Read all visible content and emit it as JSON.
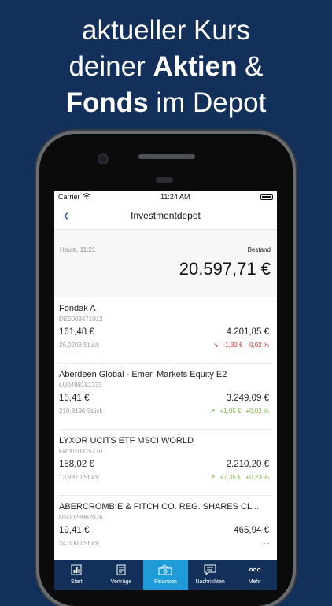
{
  "headline": {
    "line1": "aktueller Kurs",
    "line2_prefix": "deiner ",
    "line2_bold": "Aktien",
    "line2_suffix": " &",
    "line3_bold": "Fonds",
    "line3_suffix": " im Depot"
  },
  "status": {
    "carrier": "Carrier",
    "time": "11:24 AM"
  },
  "nav": {
    "title": "Investmentdepot",
    "back": "‹"
  },
  "summary": {
    "date": "Heute, 11:21",
    "label": "Bestand",
    "total": "20.597,71 €"
  },
  "holdings": [
    {
      "name": "Fondak A",
      "isin": "DE0008471012",
      "price": "161,48 €",
      "qty": "26,0208 Stück",
      "value": "4.201,85 €",
      "arrow": "↘",
      "abs": "-1,30 €",
      "pct": "-0,02 %",
      "trend": "neg"
    },
    {
      "name": "Aberdeen Global - Emer. Markets Equity E2",
      "isin": "LU0498181733",
      "price": "15,41 €",
      "qty": "210,8196 Stück",
      "value": "3.249,09 €",
      "arrow": "↗",
      "abs": "+1,05 €",
      "pct": "+0,02 %",
      "trend": "pos"
    },
    {
      "name": "LYXOR UCITS ETF MSCI WORLD",
      "isin": "FR0010315770",
      "price": "158,02 €",
      "qty": "13,9870 Stück",
      "value": "2.210,20 €",
      "arrow": "↗",
      "abs": "+7,35 €",
      "pct": "+0,23 %",
      "trend": "pos"
    },
    {
      "name": "ABERCROMBIE & FITCH CO. REG. SHARES CL...",
      "isin": "US0028962076",
      "price": "19,41 €",
      "qty": "24,0000 Stück",
      "value": "465,94 €",
      "arrow": "",
      "abs": "",
      "pct": "- -",
      "trend": "neu"
    }
  ],
  "tabs": [
    {
      "label": "Start",
      "icon": "chart-icon"
    },
    {
      "label": "Verträge",
      "icon": "document-icon"
    },
    {
      "label": "Finanzen",
      "icon": "money-icon"
    },
    {
      "label": "Nachrichten",
      "icon": "message-icon"
    },
    {
      "label": "Mehr",
      "icon": "more-icon"
    }
  ],
  "colors": {
    "brand": "#12305a",
    "active_tab": "#1f9bd7",
    "negative": "#d32f2f",
    "positive": "#7cb342"
  }
}
